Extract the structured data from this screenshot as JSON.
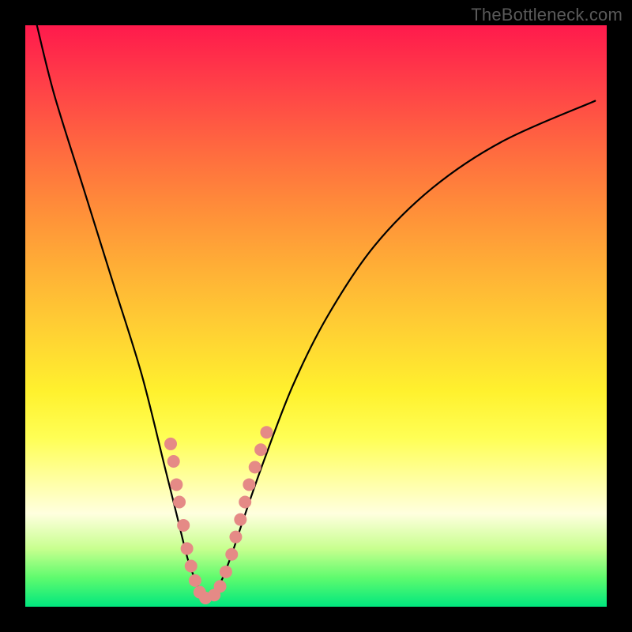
{
  "watermark": "TheBottleneck.com",
  "colors": {
    "background": "#000000",
    "gradient_top": "#ff1a4c",
    "gradient_bottom": "#00e77e",
    "curve": "#000000",
    "dot": "#e58a86"
  },
  "chart_data": {
    "type": "line",
    "title": "",
    "xlabel": "",
    "ylabel": "",
    "xlim": [
      0,
      100
    ],
    "ylim": [
      0,
      100
    ],
    "grid": false,
    "legend": false,
    "series": [
      {
        "name": "bottleneck-curve",
        "x": [
          2,
          5,
          10,
          15,
          20,
          24,
          26,
          28,
          29.5,
          30.5,
          31.5,
          33.5,
          35.5,
          37.5,
          41,
          46,
          52,
          60,
          70,
          82,
          98
        ],
        "y": [
          100,
          88,
          72,
          56,
          40,
          24,
          16,
          8,
          4,
          1.5,
          1.5,
          4,
          9,
          15,
          25,
          38,
          50,
          62,
          72,
          80,
          87
        ]
      }
    ],
    "data_points": [
      {
        "x": 25.0,
        "y": 28.0
      },
      {
        "x": 25.5,
        "y": 25.0
      },
      {
        "x": 26.0,
        "y": 21.0
      },
      {
        "x": 26.5,
        "y": 18.0
      },
      {
        "x": 27.2,
        "y": 14.0
      },
      {
        "x": 27.8,
        "y": 10.0
      },
      {
        "x": 28.5,
        "y": 7.0
      },
      {
        "x": 29.2,
        "y": 4.5
      },
      {
        "x": 30.0,
        "y": 2.5
      },
      {
        "x": 31.0,
        "y": 1.5
      },
      {
        "x": 32.5,
        "y": 2.0
      },
      {
        "x": 33.5,
        "y": 3.5
      },
      {
        "x": 34.5,
        "y": 6.0
      },
      {
        "x": 35.5,
        "y": 9.0
      },
      {
        "x": 36.2,
        "y": 12.0
      },
      {
        "x": 37.0,
        "y": 15.0
      },
      {
        "x": 37.8,
        "y": 18.0
      },
      {
        "x": 38.5,
        "y": 21.0
      },
      {
        "x": 39.5,
        "y": 24.0
      },
      {
        "x": 40.5,
        "y": 27.0
      },
      {
        "x": 41.5,
        "y": 30.0
      }
    ]
  }
}
